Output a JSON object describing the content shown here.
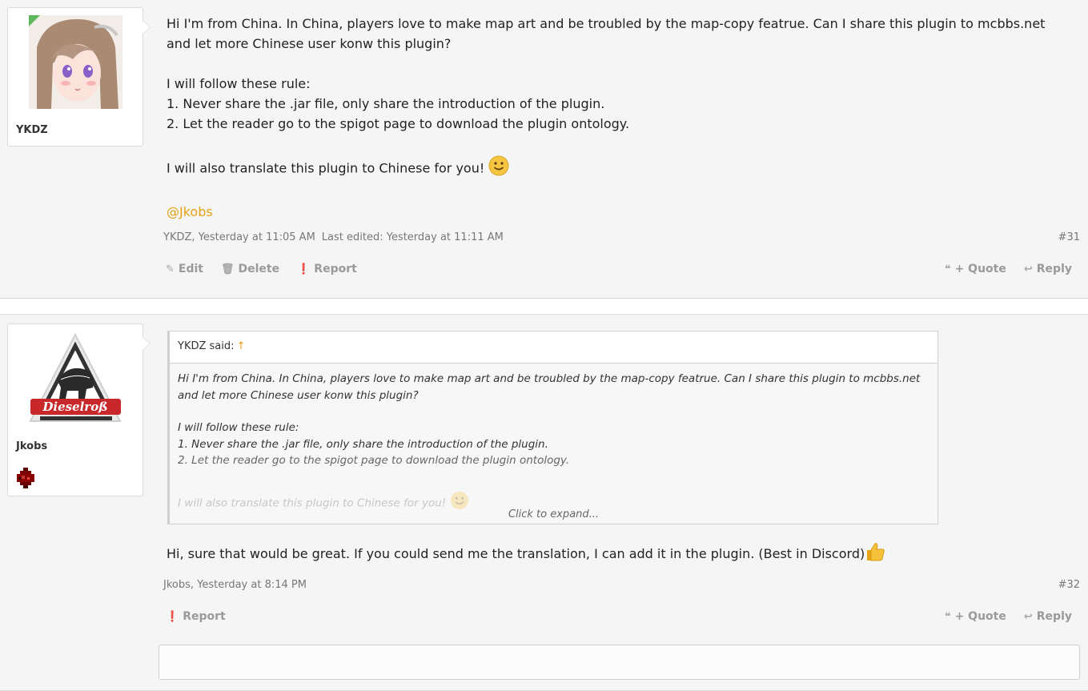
{
  "posts": [
    {
      "username": "YKDZ",
      "message_lines": [
        "Hi I'm from China. In China, players love to make map art and be troubled by the map-copy featrue. Can I share this plugin to mcbbs.net and let more Chinese user konw this plugin?",
        "I will follow these rule:",
        "1. Never share the .jar file, only share the introduction of the plugin.",
        "2. Let the reader go to the spigot page to download the plugin ontology.",
        "I will also translate this plugin to Chinese for you!"
      ],
      "mention": "@Jkobs",
      "meta_author_time": "YKDZ, Yesterday at 11:05 AM",
      "meta_edited": "Last edited: Yesterday at 11:11 AM",
      "post_number": "#31",
      "controls": [
        "Edit",
        "Delete",
        "Report"
      ],
      "controls_right": [
        "+ Quote",
        "Reply"
      ]
    },
    {
      "username": "Jkobs",
      "quote": {
        "header": "YKDZ said:",
        "arrow": "↑",
        "lines": [
          "Hi I'm from China. In China, players love to make map art and be troubled by the map-copy featrue. Can I share this plugin to mcbbs.net and let more Chinese user konw this plugin?",
          "I will follow these rule:",
          "1. Never share the .jar file, only share the introduction of the plugin.",
          "2. Let the reader go to the spigot page to download the plugin ontology.",
          "I will also translate this plugin to Chinese for you!"
        ],
        "expand_label": "Click to expand..."
      },
      "message": "Hi, sure that would be great. If you could send me the translation, I can add it in the plugin. (Best in Discord)",
      "meta_author_time": "Jkobs, Yesterday at 8:14 PM",
      "post_number": "#32",
      "controls": [
        "Report"
      ],
      "controls_right": [
        "+ Quote",
        "Reply"
      ],
      "avatar_text": "Dieselroß"
    }
  ],
  "colors": {
    "mention": "#e6a117",
    "background": "#f5f5f5",
    "control_gray": "#9a9a9a"
  }
}
